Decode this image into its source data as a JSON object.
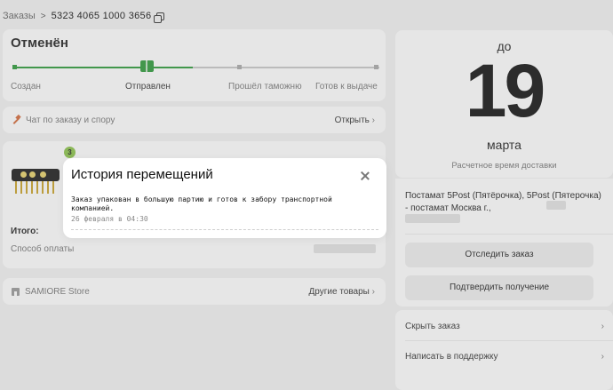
{
  "breadcrumb": {
    "orders": "Заказы",
    "separator": ">",
    "order_number": "5323 4065 1000 3656"
  },
  "status": {
    "title": "Отменён",
    "stages": [
      "Создан",
      "Отправлен",
      "Прошёл таможню",
      "Готов к выдаче"
    ],
    "current_stage_index": 1,
    "colors": {
      "done": "#2d9a3a",
      "todo": "#c8c8c8"
    }
  },
  "chat": {
    "label": "Чат по заказу и спору",
    "action": "Открыть"
  },
  "product": {
    "quantity": "3",
    "total_label": "Итого:",
    "payment_label": "Способ оплаты"
  },
  "store": {
    "name": "SAMIORE Store",
    "action": "Другие товары"
  },
  "delivery": {
    "prefix": "до",
    "day": "19",
    "month": "марта",
    "eta_label": "Расчетное время доставки"
  },
  "address": {
    "text": "Постамат 5Post (Пятёрочка), 5Post (Пятерочка) - постамат Москва г.,",
    "track_button": "Отследить заказ",
    "confirm_button": "Подтвердить получение"
  },
  "links": {
    "hide_order": "Скрыть заказ",
    "support": "Написать в поддержку"
  },
  "modal": {
    "title": "История перемещений",
    "event_text": "Заказ упакован в большую партию и готов к забору транспортной компанией.",
    "event_date": "26 февраля в 04:30"
  }
}
